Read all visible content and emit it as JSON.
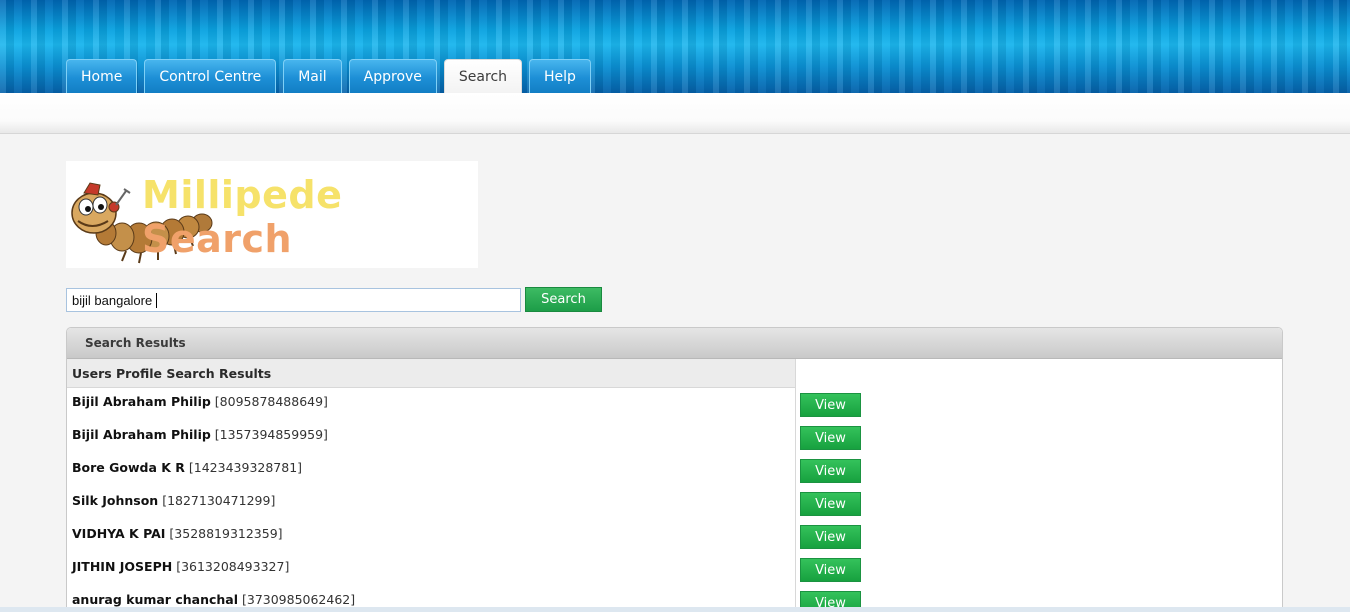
{
  "nav": {
    "tabs": [
      {
        "label": "Home"
      },
      {
        "label": "Control Centre"
      },
      {
        "label": "Mail"
      },
      {
        "label": "Approve"
      },
      {
        "label": "Search",
        "active": true
      },
      {
        "label": "Help"
      }
    ]
  },
  "logo": {
    "text_part1": "Millipede",
    "text_part2": "Search"
  },
  "search": {
    "value": "bijil bangalore",
    "button_label": "Search"
  },
  "results": {
    "panel_title": "Search Results",
    "column_header": "Users Profile Search Results",
    "view_label": "View",
    "rows": [
      {
        "name": "Bijil Abraham Philip",
        "id": "[8095878488649]"
      },
      {
        "name": "Bijil Abraham Philip",
        "id": "[1357394859959]"
      },
      {
        "name": "Bore Gowda K R",
        "id": "[1423439328781]"
      },
      {
        "name": "Silk Johnson",
        "id": "[1827130471299]"
      },
      {
        "name": "VIDHYA K PAI",
        "id": "[3528819312359]"
      },
      {
        "name": "JITHIN JOSEPH",
        "id": "[3613208493327]"
      },
      {
        "name": "anurag kumar chanchal",
        "id": "[3730985062462]"
      }
    ]
  },
  "colors": {
    "header_blue": "#0a8fd3",
    "button_green": "#1d9d48"
  }
}
